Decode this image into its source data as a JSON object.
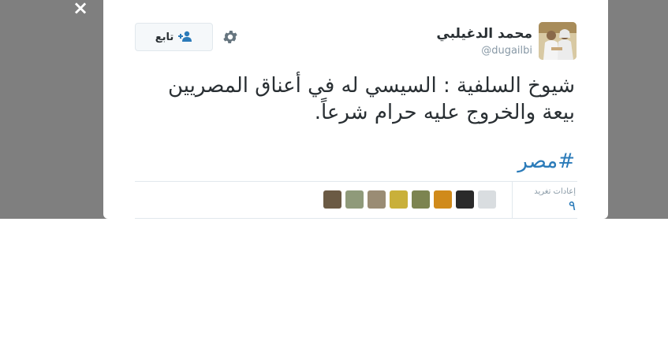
{
  "modal": {
    "close_label": "×",
    "author": {
      "name": "محمد الدغيلبي",
      "handle": "@dugailbi"
    },
    "follow_label": "تابع",
    "tweet": {
      "text": "شيوخ السلفية : السيسي له في أعناق المصريين بيعة والخروج عليه حرام شرعاً.",
      "hashtag": "#مصر"
    },
    "stats": {
      "retweets_label": "إعادات تغريد",
      "retweets_value": "٩"
    },
    "retweeters": [
      {
        "name": "retweeter-avatar-1",
        "color": "#6b5a44"
      },
      {
        "name": "retweeter-avatar-2",
        "color": "#8f9a7a"
      },
      {
        "name": "retweeter-avatar-3",
        "color": "#9a8c74"
      },
      {
        "name": "retweeter-avatar-4",
        "color": "#c9b03a"
      },
      {
        "name": "retweeter-avatar-5",
        "color": "#7c8450"
      },
      {
        "name": "retweeter-avatar-6",
        "color": "#d08a1a"
      },
      {
        "name": "retweeter-avatar-7",
        "color": "#2a2a2a"
      },
      {
        "name": "retweeter-avatar-8",
        "color": "#d9dde0"
      }
    ],
    "colors": {
      "overlay": "#7f7f7f",
      "link": "#2b7bb9",
      "text": "#292f33",
      "muted": "#8899a6"
    }
  }
}
